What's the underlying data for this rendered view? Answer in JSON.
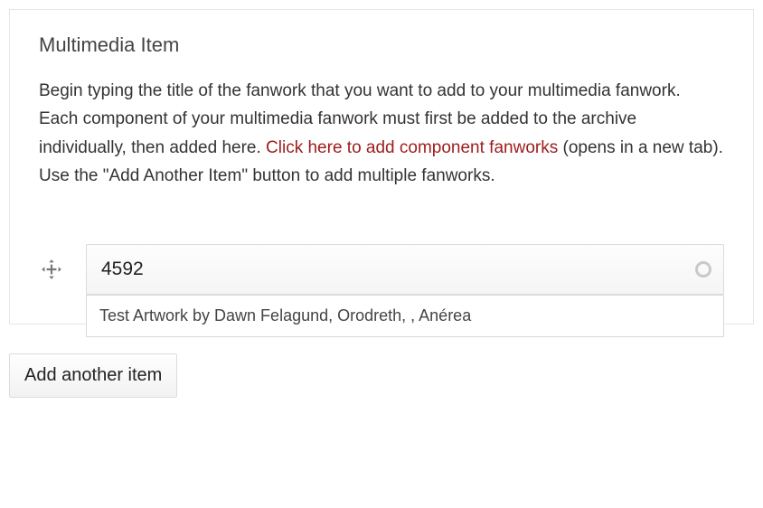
{
  "card": {
    "title": "Multimedia Item",
    "desc_part1": "Begin typing the title of the fanwork that you want to add to your multimedia fanwork. Each component of your multimedia fanwork must first be added to the archive individually, then added here. ",
    "link_text": "Click here to add component fanworks",
    "desc_part2": " (opens in a new tab). Use the \"Add Another Item\" button to add multiple fanworks."
  },
  "item": {
    "input_value": "4592",
    "suggestion": "Test Artwork by Dawn Felagund, Orodreth, , Anérea"
  },
  "add_button_label": "Add another item"
}
